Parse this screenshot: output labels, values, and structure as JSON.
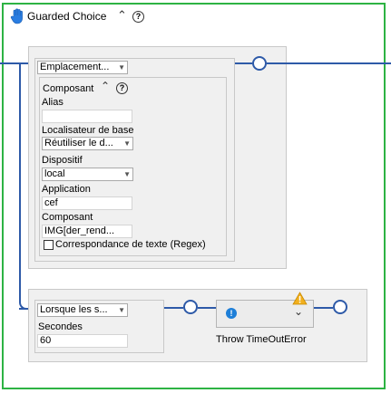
{
  "header": {
    "title": "Guarded Choice",
    "collapse_icon": "chevron-up-icon",
    "help_icon": "help-icon",
    "hand_icon": "hand-icon"
  },
  "location": {
    "dropdown_value": "Emplacement...",
    "component_title": "Composant",
    "alias_label": "Alias",
    "alias_value": "",
    "base_locator_label": "Localisateur de base",
    "base_locator_value": "Réutiliser le d...",
    "device_label": "Dispositif",
    "device_value": "local",
    "application_label": "Application",
    "application_value": "cef",
    "component_label": "Composant",
    "component_value": "IMG[der_rend...",
    "regex_label": "Correspondance de texte (Regex)",
    "regex_checked": false
  },
  "timeout": {
    "dropdown_value": "Lorsque les s...",
    "seconds_label": "Secondes",
    "seconds_value": "60",
    "action_label": "Throw TimeOutError",
    "info_icon": "info-icon",
    "warning_icon": "warning-icon",
    "expand_icon": "chevron-down-icon"
  },
  "colors": {
    "border_green": "#2db343",
    "wire_blue": "#2e5aa8",
    "info_blue": "#1e7fd8",
    "warning_yellow": "#f2b01e"
  }
}
